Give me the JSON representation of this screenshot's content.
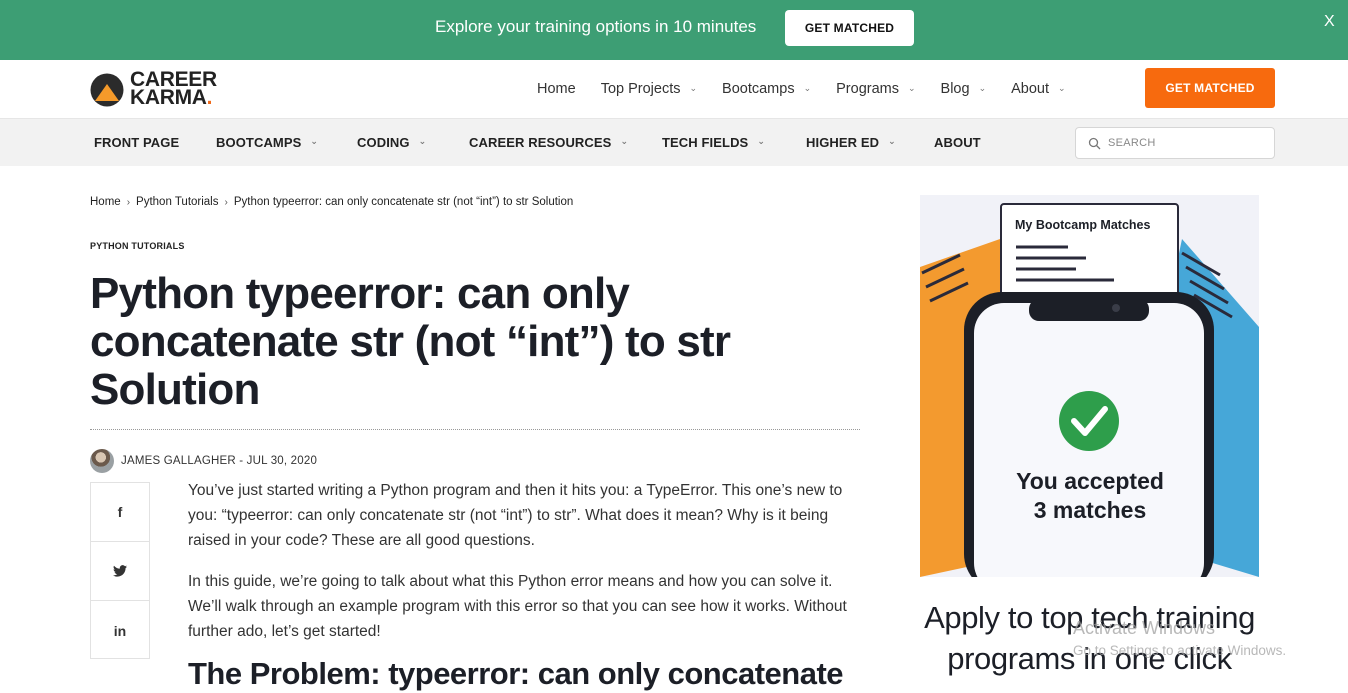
{
  "promo": {
    "text": "Explore your training options in 10 minutes",
    "button": "GET MATCHED",
    "close": "X"
  },
  "header": {
    "logo_line1": "CAREER",
    "logo_line2": "KARMA",
    "nav": [
      "Home",
      "Top Projects",
      "Bootcamps",
      "Programs",
      "Blog",
      "About"
    ],
    "cta": "GET MATCHED"
  },
  "catnav": {
    "items": [
      "FRONT PAGE",
      "BOOTCAMPS",
      "CODING",
      "CAREER RESOURCES",
      "TECH FIELDS",
      "HIGHER ED",
      "ABOUT"
    ],
    "search_placeholder": "SEARCH"
  },
  "breadcrumb": [
    "Home",
    "Python Tutorials",
    "Python typeerror: can only concatenate str (not “int”) to str Solution"
  ],
  "article": {
    "category": "PYTHON TUTORIALS",
    "title": "Python typeerror: can only concatenate str (not “int”) to str Solution",
    "author": "JAMES GALLAGHER",
    "date_sep": " - ",
    "date": "JUL 30, 2020",
    "share": [
      "f",
      "t",
      "in"
    ],
    "paragraphs": [
      "You’ve just started writing a Python program and then it hits you: a TypeError. This one’s new to you: “typeerror: can only concatenate str (not “int”) to str”. What does it mean? Why is it being raised in your code? These are all good questions.",
      "In this guide, we’re going to talk about what this Python error means and how you can solve it. We’ll walk through an example program with this error so that you can see how it works. Without further ado, let’s get started!"
    ],
    "h2": "The Problem: typeerror: can only concatenate"
  },
  "sidebar": {
    "card_title": "My Bootcamp Matches",
    "phone_text_line1": "You accepted",
    "phone_text_line2": "3 matches",
    "headline": "Apply to top tech training programs in one click",
    "colors": {
      "orange": "#f39a2f",
      "blue": "#46a7d8",
      "green": "#2e9e4b"
    }
  },
  "watermark": {
    "title": "Activate Windows",
    "subtitle": "Go to Settings to activate Windows."
  }
}
